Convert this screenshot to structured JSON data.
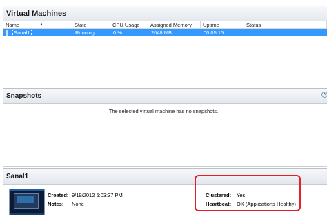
{
  "vm_panel": {
    "title": "Virtual Machines",
    "columns": [
      "Name",
      "State",
      "CPU Usage",
      "Assigned Memory",
      "Uptime",
      "Status"
    ],
    "rows": [
      {
        "name": "Sanal1",
        "state": "Running",
        "cpu": "0 %",
        "memory": "2048 MB",
        "uptime": "00:05:15",
        "status": ""
      }
    ]
  },
  "snapshots_panel": {
    "title": "Snapshots",
    "empty_message": "The selected virtual machine has no snapshots."
  },
  "detail_panel": {
    "title": "Sanal1",
    "created_label": "Created:",
    "created_value": "9/19/2012 5:03:37 PM",
    "notes_label": "Notes:",
    "notes_value": "None",
    "clustered_label": "Clustered:",
    "clustered_value": "Yes",
    "heartbeat_label": "Heartbeat:",
    "heartbeat_value": "OK (Applications Healthy)"
  },
  "icons": {
    "collapse": "collapse-chevron-icon",
    "sort": "sort-ascending-icon"
  },
  "colors": {
    "selection": "#3399ff",
    "annotation": "#e3202a"
  }
}
